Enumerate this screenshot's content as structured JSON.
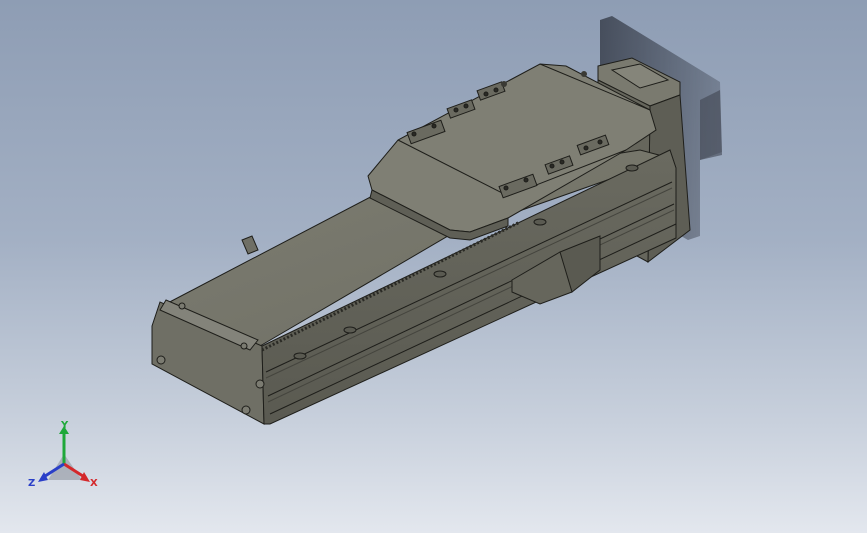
{
  "view": {
    "background_top": "#8e9db4",
    "background_bottom": "#e3e7ee",
    "model_color": "#77776c",
    "edge_color": "#1e1e1a"
  },
  "triad": {
    "x_label": "X",
    "y_label": "Y",
    "z_label": "Z",
    "x_color": "#d4282b",
    "y_color": "#1fa83a",
    "z_color": "#2a3fc8"
  }
}
